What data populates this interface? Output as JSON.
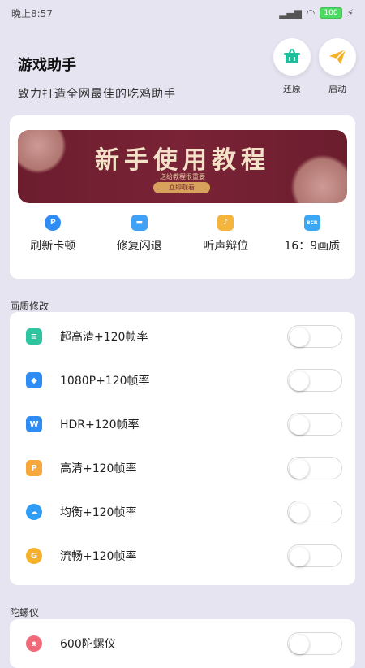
{
  "status": {
    "time": "晚上8:57",
    "battery": "100"
  },
  "header": {
    "title": "游戏助手",
    "subtitle": "致力打造全网最佳的吃鸡助手",
    "restore_label": "还原",
    "launch_label": "启动"
  },
  "banner": {
    "title": "新手使用教程",
    "sub": "送给教程很重要",
    "button": "立即观看"
  },
  "quick": [
    {
      "label": "刷新卡顿",
      "icon": "refresh-icon",
      "color": "#2f8cf5"
    },
    {
      "label": "修复闪退",
      "icon": "repair-icon",
      "color": "#3fa0f7"
    },
    {
      "label": "听声辩位",
      "icon": "sound-icon",
      "color": "#f5b53c"
    },
    {
      "label": "16：9画质",
      "icon": "ratio-icon",
      "color": "#3aa7f5"
    }
  ],
  "sections": {
    "quality_title": "画质修改",
    "gyro_title": "陀螺仪"
  },
  "quality_rows": [
    {
      "label": "超高清+120帧率",
      "icon": "uhd-icon",
      "color": "#2ec4a0",
      "enabled": false
    },
    {
      "label": "1080P+120帧率",
      "icon": "layers-icon",
      "color": "#2f8cf5",
      "enabled": false
    },
    {
      "label": "HDR+120帧率",
      "icon": "w-icon",
      "color": "#2f8cf5",
      "enabled": false
    },
    {
      "label": "高清+120帧率",
      "icon": "p-icon",
      "color": "#f7a83c",
      "enabled": false
    },
    {
      "label": "均衡+120帧率",
      "icon": "cloud-icon",
      "color": "#2f9cf5",
      "enabled": false
    },
    {
      "label": "流畅+120帧率",
      "icon": "g-icon",
      "color": "#f5b02c",
      "enabled": false
    }
  ],
  "gyro_rows": [
    {
      "label": "600陀螺仪",
      "icon": "gyro-icon",
      "color": "#f06a7a",
      "enabled": false
    }
  ]
}
